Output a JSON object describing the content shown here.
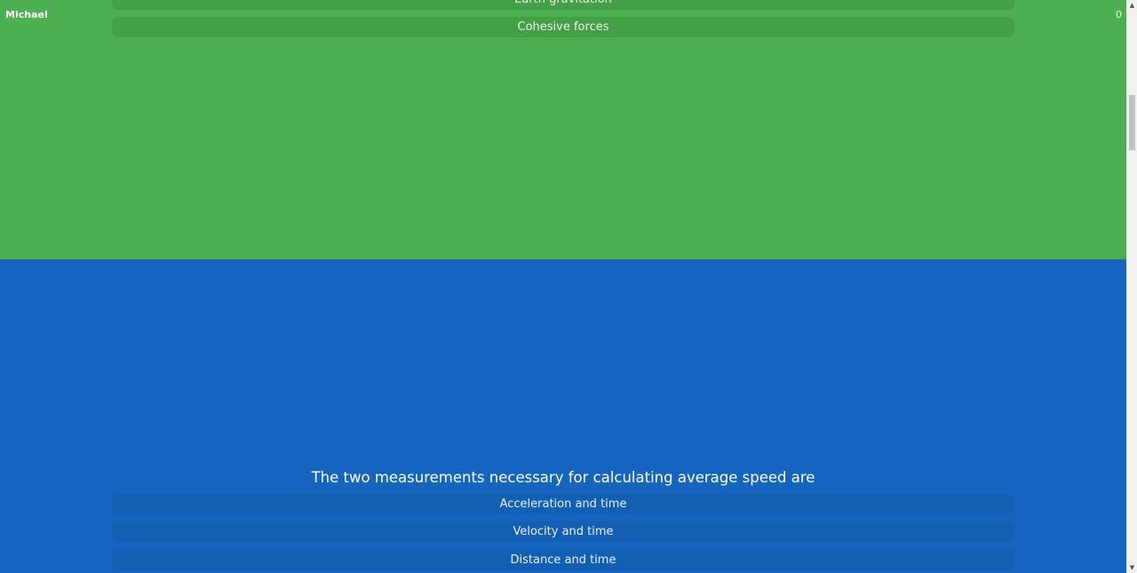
{
  "player": {
    "name": "Michael",
    "score": "0"
  },
  "previous_question": {
    "answers": [
      {
        "label": "Earth gravitation"
      },
      {
        "label": "Cohesive forces"
      }
    ]
  },
  "current_question": {
    "text": "The two measurements necessary for calculating average speed are",
    "answers": [
      {
        "label": "Acceleration and time"
      },
      {
        "label": "Velocity and time"
      },
      {
        "label": "Distance and time"
      }
    ]
  },
  "colors": {
    "green_section": "#4caf50",
    "blue_section": "#1565c0"
  },
  "scrollbar": {
    "up_icon": "up-arrow",
    "down_icon": "down-arrow"
  }
}
